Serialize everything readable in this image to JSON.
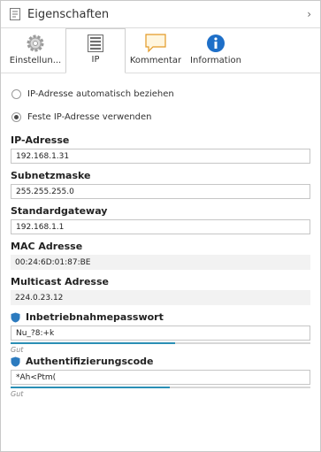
{
  "panel": {
    "title": "Eigenschaften",
    "collapse_icon": "chevron-right-icon"
  },
  "tabs": [
    {
      "label": "Einstellun...",
      "icon": "gear-icon",
      "active": false
    },
    {
      "label": "IP",
      "icon": "network-list-icon",
      "active": true
    },
    {
      "label": "Kommentar",
      "icon": "comment-icon",
      "active": false
    },
    {
      "label": "Information",
      "icon": "info-icon",
      "active": false
    }
  ],
  "ip_mode": {
    "auto_label": "IP-Adresse automatisch beziehen",
    "fixed_label": "Feste IP-Adresse verwenden",
    "selected": "fixed"
  },
  "fields": {
    "ip_address": {
      "label": "IP-Adresse",
      "value": "192.168.1.31"
    },
    "subnet_mask": {
      "label": "Subnetzmaske",
      "value": "255.255.255.0"
    },
    "gateway": {
      "label": "Standardgateway",
      "value": "192.168.1.1"
    },
    "mac": {
      "label": "MAC Adresse",
      "value": "00:24:6D:01:87:BE"
    },
    "multicast": {
      "label": "Multicast Adresse",
      "value": "224.0.23.12"
    }
  },
  "commissioning_password": {
    "label": "Inbetriebnahmepasswort",
    "value": "Nu_?8:+k",
    "strength_label": "Gut",
    "strength_fraction": 0.55
  },
  "auth_code": {
    "label": "Authentifizierungscode",
    "value": "*Ah<Ptm(",
    "strength_label": "Gut",
    "strength_fraction": 0.53
  },
  "colors": {
    "accent": "#2a8fb5",
    "shield": "#2c7bbf",
    "info": "#1e6fc8",
    "comment": "#f0a830"
  }
}
